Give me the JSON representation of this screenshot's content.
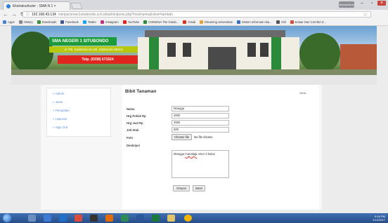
{
  "browser": {
    "tab_title": "Ekstrakurikuler - SMA N 1 ×",
    "tab_close": "×",
    "user_chip": "Anonymous",
    "omnibox_host": "192.168.43.134",
    "omnibox_path": "/skripsi/sman1situbondo.sch.id/admin/jenis.php?mod=jenis&view=tambah",
    "bookmarks": [
      {
        "label": "Apps",
        "color": "#4a7fd1"
      },
      {
        "label": "History",
        "color": "#888888"
      },
      {
        "label": "Downloads",
        "color": "#3a8f3a"
      },
      {
        "label": "Facebook",
        "color": "#3b5998"
      },
      {
        "label": "Twitter",
        "color": "#1da1f2"
      },
      {
        "label": "Instagram",
        "color": "#c13584"
      },
      {
        "label": "YouTube",
        "color": "#e62117"
      },
      {
        "label": "CONSINA The Outdo...",
        "color": "#2a8a3a"
      },
      {
        "label": "Gmail",
        "color": "#d93025"
      },
      {
        "label": "Elearning Universitas",
        "color": "#e8a33a"
      },
      {
        "label": "Sistem Informasi Aka...",
        "color": "#3a6fc0"
      },
      {
        "label": "Ahli",
        "color": "#555555"
      },
      {
        "label": "Keluar Dari Comfort Z...",
        "color": "#d94b3c"
      }
    ]
  },
  "header": {
    "school_name": "SMA NEGERI 1 SITUBONDO",
    "address": "Jl. PB. Sudirman No.58, Situbondo 68312",
    "phone": "Telp. (0338) 671524",
    "colors": {
      "green": "#1d9a3a",
      "yellow": "#b6c90f",
      "red": "#e0251f"
    }
  },
  "sidebar": {
    "items": [
      "» Admin",
      "» Jenis",
      "» Penjualan",
      "» Laporan",
      "» Sign Out"
    ]
  },
  "form": {
    "title": "Bibit Tanaman",
    "jenis_label": "Jenis",
    "fields": {
      "nama": {
        "label": "Nama",
        "value": "Mangga"
      },
      "hrg_pokok": {
        "label": "Hrg Pokok Rp",
        "value": "4000"
      },
      "hrg_jual": {
        "label": "Hrg Jual Rp",
        "value": "4500"
      },
      "jml_stok": {
        "label": "Jml Stok",
        "value": "500"
      },
      "foto": {
        "label": "Foto",
        "button": "Choose file",
        "status": "No file chosen"
      },
      "deskripsi": {
        "label": "Deskripsi",
        "value_prefix": "Mangga ",
        "value_misspelled": "manalagi",
        "value_suffix": " umur 2 bulan"
      }
    },
    "save_button": "Simpan",
    "back_button": "Batal"
  },
  "taskbar": {
    "time": "9:16 PM",
    "date": "1/12/2017"
  }
}
